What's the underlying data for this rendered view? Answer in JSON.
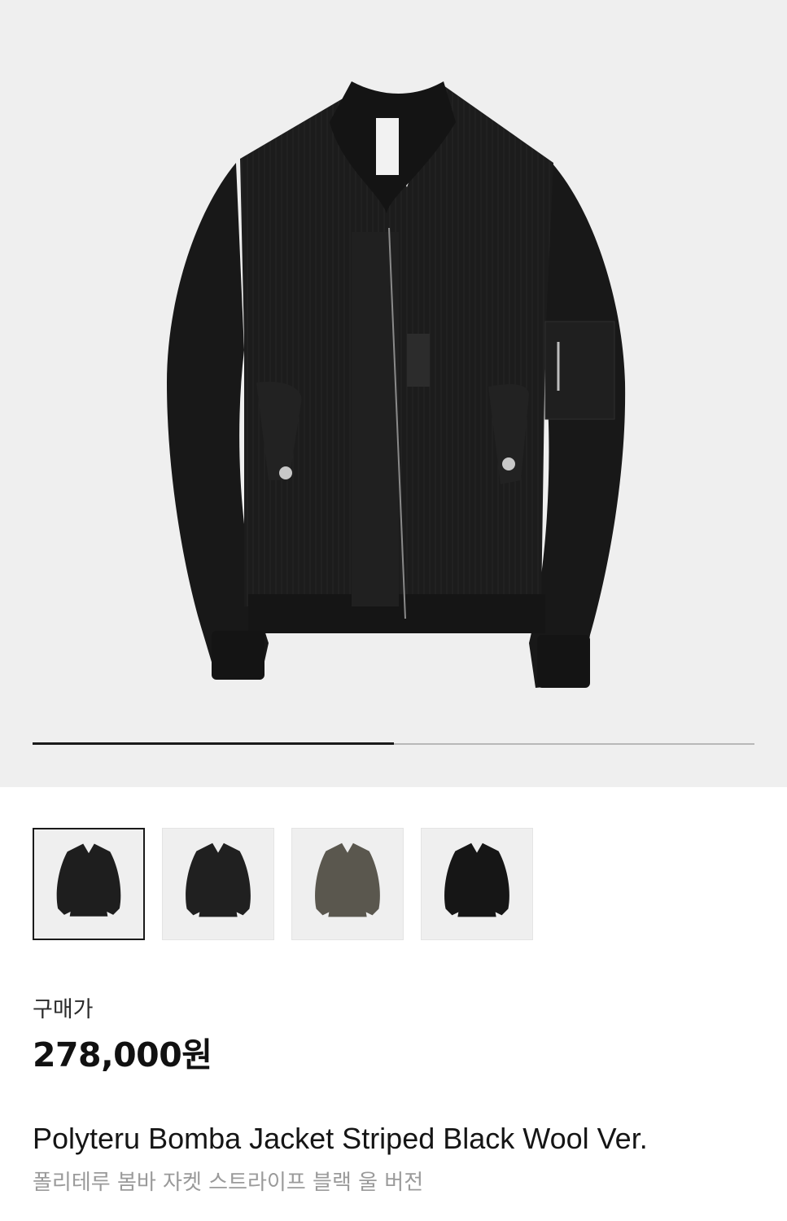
{
  "gallery": {
    "main_image": "bomber-jacket-black-striped",
    "progress_fraction": 0.5,
    "thumbnails": [
      {
        "name": "black-jacket-front",
        "color": "#1e1e1e",
        "selected": true
      },
      {
        "name": "black-jacket-zipped",
        "color": "#202020",
        "selected": false
      },
      {
        "name": "olive-jacket-front",
        "color": "#5a574e",
        "selected": false
      },
      {
        "name": "black-jacket-snap",
        "color": "#161616",
        "selected": false
      }
    ]
  },
  "product": {
    "price_label": "구매가",
    "price": "278,000원",
    "name_en": "Polyteru Bomba Jacket Striped Black Wool Ver.",
    "name_ko": "폴리테루 봄바 자켓 스트라이프 블랙 울 버전"
  },
  "colors": {
    "background": "#efefef",
    "text": "#1a1a1a",
    "subtext": "#9a9a9a"
  }
}
